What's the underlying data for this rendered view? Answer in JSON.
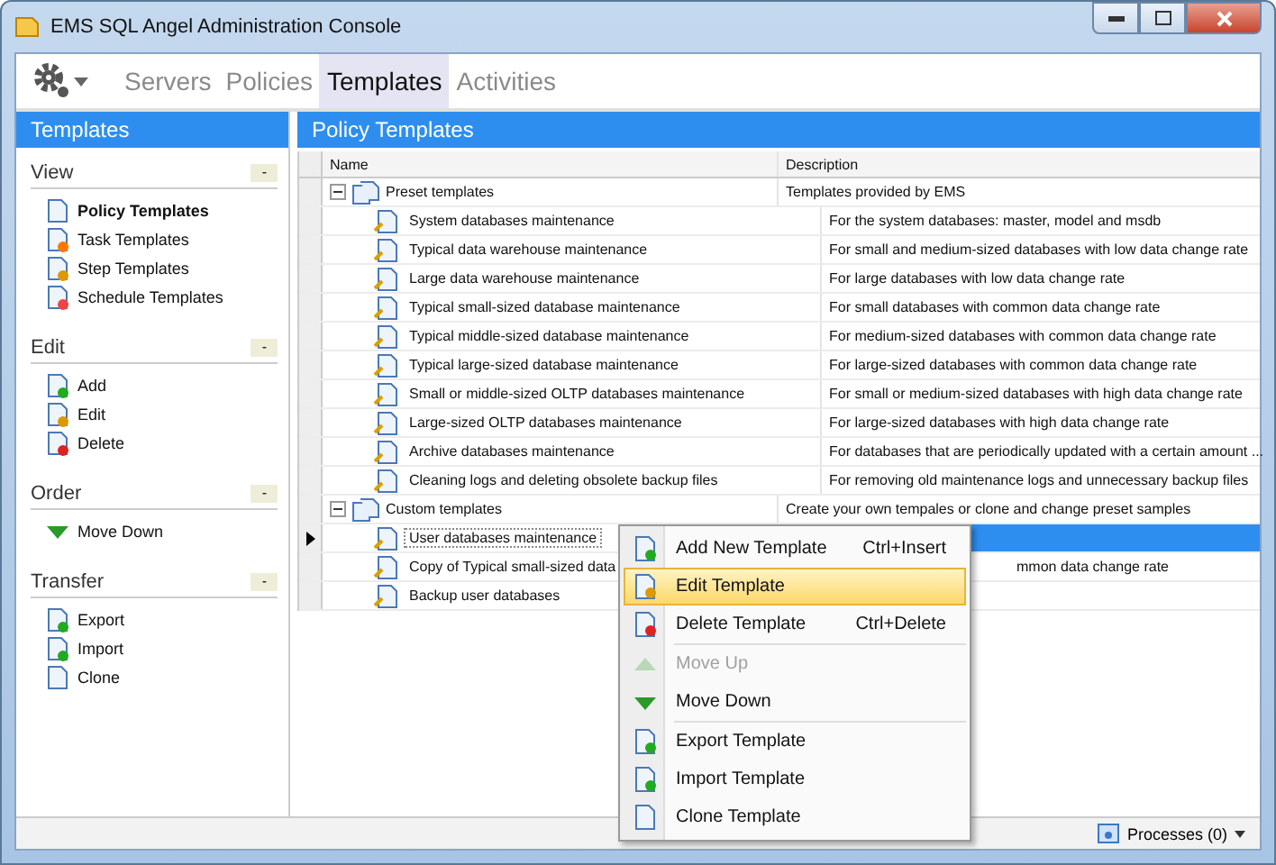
{
  "window": {
    "title": "EMS SQL Angel Administration Console"
  },
  "nav_tabs": [
    {
      "label": "Servers",
      "selected": false
    },
    {
      "label": "Policies",
      "selected": false
    },
    {
      "label": "Templates",
      "selected": true
    },
    {
      "label": "Activities",
      "selected": false
    }
  ],
  "sidebar": {
    "title": "Templates",
    "sections": [
      {
        "title": "View",
        "collapse": "-",
        "items": [
          {
            "label": "Policy Templates",
            "selected": true,
            "kind": "doc"
          },
          {
            "label": "Task Templates",
            "selected": false,
            "kind": "task"
          },
          {
            "label": "Step Templates",
            "selected": false,
            "kind": "step"
          },
          {
            "label": "Schedule Templates",
            "selected": false,
            "kind": "schedule"
          }
        ]
      },
      {
        "title": "Edit",
        "collapse": "-",
        "items": [
          {
            "label": "Add",
            "selected": false,
            "kind": "add"
          },
          {
            "label": "Edit",
            "selected": false,
            "kind": "edit"
          },
          {
            "label": "Delete",
            "selected": false,
            "kind": "delete"
          }
        ]
      },
      {
        "title": "Order",
        "collapse": "-",
        "items": [
          {
            "label": "Move Down",
            "selected": false,
            "kind": "down"
          }
        ]
      },
      {
        "title": "Transfer",
        "collapse": "-",
        "items": [
          {
            "label": "Export",
            "selected": false,
            "kind": "export"
          },
          {
            "label": "Import",
            "selected": false,
            "kind": "import"
          },
          {
            "label": "Clone",
            "selected": false,
            "kind": "clone"
          }
        ]
      }
    ]
  },
  "main": {
    "title": "Policy Templates",
    "columns": [
      "Name",
      "Description"
    ],
    "groups": [
      {
        "name": "Preset templates",
        "description": "Templates provided by EMS",
        "expanded": true,
        "children": [
          {
            "name": "System databases maintenance",
            "description": "For the system databases: master, model and msdb",
            "selected": false
          },
          {
            "name": "Typical data warehouse maintenance",
            "description": "For small and medium-sized databases with low data change rate",
            "selected": false
          },
          {
            "name": "Large data warehouse maintenance",
            "description": "For large databases with low data change rate",
            "selected": false
          },
          {
            "name": "Typical small-sized database maintenance",
            "description": "For small databases with common data change rate",
            "selected": false
          },
          {
            "name": "Typical middle-sized database maintenance",
            "description": "For medium-sized databases with common data change rate",
            "selected": false
          },
          {
            "name": "Typical large-sized database maintenance",
            "description": "For large-sized databases with common data change rate",
            "selected": false
          },
          {
            "name": "Small or middle-sized OLTP databases maintenance",
            "description": "For small or medium-sized databases with high data change rate",
            "selected": false
          },
          {
            "name": "Large-sized OLTP databases maintenance",
            "description": "For large-sized databases with high data change rate",
            "selected": false
          },
          {
            "name": "Archive databases maintenance",
            "description": "For databases that are periodically updated with a certain amount ...",
            "selected": false
          },
          {
            "name": "Cleaning logs and deleting obsolete backup files",
            "description": "For removing old maintenance logs and unnecessary backup files",
            "selected": false
          }
        ]
      },
      {
        "name": "Custom templates",
        "description": "Create your own tempales or clone and change preset samples",
        "expanded": true,
        "children": [
          {
            "name": "User databases maintenance",
            "selected": true
          },
          {
            "name": "Copy of Typical small-sized data",
            "description": "mmon data change rate",
            "selected": false,
            "covered": true
          },
          {
            "name": "Backup user databases",
            "selected": false
          }
        ]
      }
    ]
  },
  "context_menu": [
    {
      "kind": "add",
      "label": "Add New Template",
      "shortcut": "Ctrl+Insert",
      "disabled": false,
      "selected": false
    },
    {
      "kind": "edit",
      "label": "Edit Template",
      "disabled": false,
      "selected": true
    },
    {
      "kind": "delete",
      "label": "Delete Template",
      "shortcut": "Ctrl+Delete",
      "disabled": false,
      "selected": false
    },
    {
      "kind": "separator"
    },
    {
      "kind": "up",
      "label": "Move Up",
      "disabled": true,
      "selected": false
    },
    {
      "kind": "down",
      "label": "Move Down",
      "disabled": false,
      "selected": false
    },
    {
      "kind": "separator"
    },
    {
      "kind": "export",
      "label": "Export Template",
      "disabled": false,
      "selected": false
    },
    {
      "kind": "import",
      "label": "Import Template",
      "disabled": false,
      "selected": false
    },
    {
      "kind": "clone",
      "label": "Clone Template",
      "disabled": false,
      "selected": false
    }
  ],
  "status_bar": {
    "processes": "Processes (0)"
  }
}
